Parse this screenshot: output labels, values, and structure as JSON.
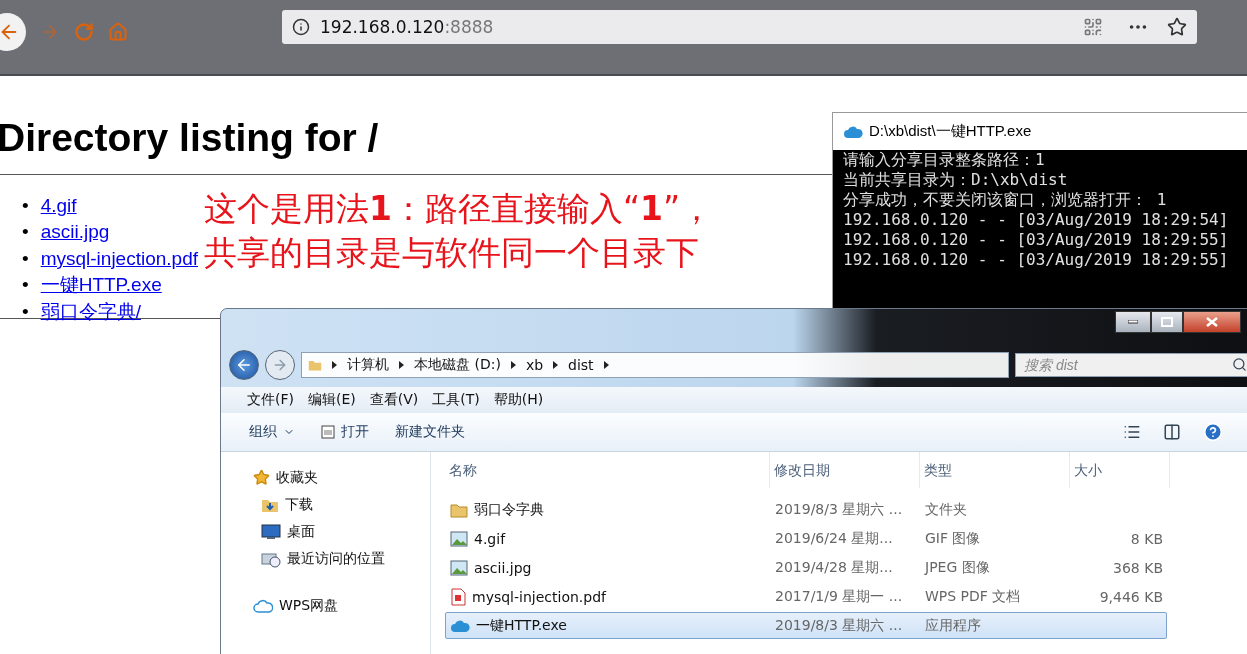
{
  "browser": {
    "url_host": "192.168.0.120",
    "url_port": ":8888"
  },
  "page": {
    "heading": "Directory listing for /",
    "files": [
      {
        "bullet": "•",
        "label": "4.gif"
      },
      {
        "bullet": "•",
        "label": "ascii.jpg"
      },
      {
        "bullet": "•",
        "label": "mysql-injection.pdf"
      },
      {
        "bullet": "•",
        "label": "一键HTTP.exe"
      },
      {
        "bullet": "•",
        "label": "弱口令字典/"
      }
    ],
    "annotation": [
      "这个是用法**1**：路径直接输入“**1**”，",
      "共享的目录是与软件同一个目录下"
    ]
  },
  "console": {
    "title": "D:\\xb\\dist\\一键HTTP.exe",
    "lines": [
      "请输入分享目录整条路径：1",
      "当前共享目录为：D:\\xb\\dist",
      "分享成功，不要关闭该窗口，浏览器打开： 1",
      "192.168.0.120 - - [03/Aug/2019 18:29:54]",
      "192.168.0.120 - - [03/Aug/2019 18:29:55]",
      "192.168.0.120 - - [03/Aug/2019 18:29:55]"
    ]
  },
  "explorer": {
    "breadcrumb": [
      "计算机",
      "本地磁盘 (D:)",
      "xb",
      "dist"
    ],
    "search": {
      "placeholder": "搜索 dist"
    },
    "menu": [
      "文件(F)",
      "编辑(E)",
      "查看(V)",
      "工具(T)",
      "帮助(H)"
    ],
    "toolbar": [
      {
        "label": "组织",
        "kind": "dropdown"
      },
      {
        "label": "打开",
        "kind": "open"
      },
      {
        "label": "新建文件夹",
        "kind": "plain"
      }
    ],
    "nav": [
      {
        "label": "收藏夹",
        "kind": "star",
        "children": [
          {
            "label": "下载",
            "kind": "download"
          },
          {
            "label": "桌面",
            "kind": "desktop"
          },
          {
            "label": "最近访问的位置",
            "kind": "recent"
          }
        ]
      },
      {
        "label": "WPS网盘",
        "kind": "cloud"
      }
    ],
    "columns": [
      "名称",
      "修改日期",
      "类型",
      "大小"
    ],
    "rows": [
      {
        "kind": "folder",
        "name": "弱口令字典",
        "date": "2019/8/3 星期六 ...",
        "type": "文件夹",
        "selected": false
      },
      {
        "kind": "image",
        "name": "4.gif",
        "date": "2019/6/24 星期...",
        "type": "GIF 图像",
        "size": "8 KB",
        "selected": false
      },
      {
        "kind": "image",
        "name": "ascii.jpg",
        "date": "2019/4/28 星期...",
        "type": "JPEG 图像",
        "size": "368 KB",
        "selected": false
      },
      {
        "kind": "pdf",
        "name": "mysql-injection.pdf",
        "date": "2017/1/9 星期一 ...",
        "type": "WPS PDF 文档",
        "size": "9,446 KB",
        "selected": false
      },
      {
        "kind": "app",
        "name": "一键HTTP.exe",
        "date": "2019/8/3 星期六 ...",
        "type": "应用程序",
        "selected": true
      }
    ]
  }
}
